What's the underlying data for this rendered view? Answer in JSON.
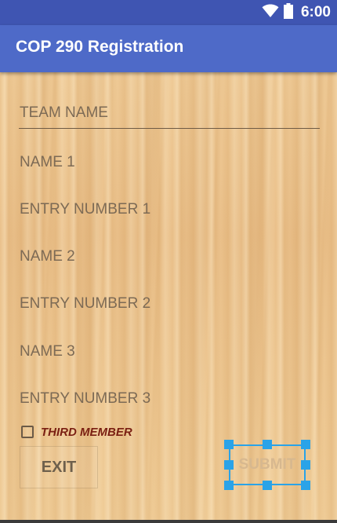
{
  "status_bar": {
    "time": "6:00",
    "icons": [
      "wifi-icon",
      "battery-icon"
    ]
  },
  "app_bar": {
    "title": "COP 290 Registration"
  },
  "form": {
    "team_name": {
      "placeholder": "TEAM NAME",
      "value": ""
    },
    "name_1": {
      "placeholder": "NAME 1",
      "value": ""
    },
    "entry_number_1": {
      "placeholder": "ENTRY NUMBER 1",
      "value": ""
    },
    "name_2": {
      "placeholder": "NAME 2",
      "value": ""
    },
    "entry_number_2": {
      "placeholder": "ENTRY NUMBER 2",
      "value": ""
    },
    "name_3": {
      "placeholder": "NAME 3",
      "value": ""
    },
    "entry_number_3": {
      "placeholder": "ENTRY NUMBER 3",
      "value": ""
    },
    "third_member": {
      "label": "THIRD MEMBER",
      "checked": false
    }
  },
  "buttons": {
    "exit_label": "EXIT",
    "submit_label": "SUBMIT"
  },
  "colors": {
    "status_bar": "#3f55b2",
    "app_bar": "#4e6ac8",
    "checkbox_label": "#7a1f12",
    "selection_handles": "#2aa3e8"
  }
}
